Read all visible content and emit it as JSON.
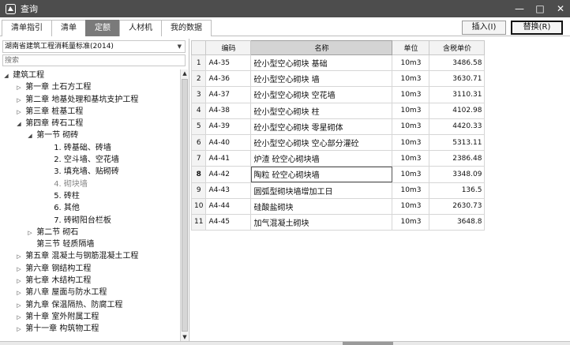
{
  "window": {
    "title": "查询",
    "minimize": "—",
    "maximize": "□",
    "close": "✕"
  },
  "tabs": [
    "清单指引",
    "清单",
    "定额",
    "人材机",
    "我的数据"
  ],
  "buttons": {
    "insert": "插入(I)",
    "replace": "替换(R)"
  },
  "library": {
    "selected": "湖南省建筑工程消耗量标准(2014)",
    "search_placeholder": "搜索"
  },
  "tree": [
    {
      "label": "建筑工程",
      "toggle": "◢",
      "level": 0
    },
    {
      "label": "第一章 土石方工程",
      "toggle": "▷",
      "level": 1
    },
    {
      "label": "第二章 地基处理和基坑支护工程",
      "toggle": "▷",
      "level": 1
    },
    {
      "label": "第三章 桩基工程",
      "toggle": "▷",
      "level": 1
    },
    {
      "label": "第四章 砖石工程",
      "toggle": "◢",
      "level": 1
    },
    {
      "label": "第一节 砌砖",
      "toggle": "◢",
      "level": 2
    },
    {
      "label": "1. 砖基础、砖墙",
      "toggle": "",
      "level": 3
    },
    {
      "label": "2. 空斗墙、空花墙",
      "toggle": "",
      "level": 3
    },
    {
      "label": "3. 填充墙、贴砌砖",
      "toggle": "",
      "level": 3
    },
    {
      "label": "4. 砌块墙",
      "toggle": "",
      "level": 3,
      "muted": true
    },
    {
      "label": "5. 砖柱",
      "toggle": "",
      "level": 3
    },
    {
      "label": "6. 其他",
      "toggle": "",
      "level": 3
    },
    {
      "label": "7. 砖砌阳台栏板",
      "toggle": "",
      "level": 3
    },
    {
      "label": "第二节 砌石",
      "toggle": "▷",
      "level": 2
    },
    {
      "label": "第三节 轻质隔墙",
      "toggle": "",
      "level": 2
    },
    {
      "label": "第五章 混凝土与钢筋混凝土工程",
      "toggle": "▷",
      "level": 1
    },
    {
      "label": "第六章 钢结构工程",
      "toggle": "▷",
      "level": 1
    },
    {
      "label": "第七章 木结构工程",
      "toggle": "▷",
      "level": 1
    },
    {
      "label": "第八章 屋面与防水工程",
      "toggle": "▷",
      "level": 1
    },
    {
      "label": "第九章 保温隔热、防腐工程",
      "toggle": "▷",
      "level": 1
    },
    {
      "label": "第十章 室外附属工程",
      "toggle": "▷",
      "level": 1
    },
    {
      "label": "第十一章 构筑物工程",
      "toggle": "▷",
      "level": 1
    }
  ],
  "table": {
    "columns": [
      "",
      "编码",
      "名称",
      "单位",
      "含税单价"
    ],
    "rows": [
      {
        "no": "1",
        "code": "A4-35",
        "name": "砼小型空心砌块 基础",
        "unit": "10m3",
        "price": "3486.58"
      },
      {
        "no": "2",
        "code": "A4-36",
        "name": "砼小型空心砌块 墙",
        "unit": "10m3",
        "price": "3630.71"
      },
      {
        "no": "3",
        "code": "A4-37",
        "name": "砼小型空心砌块 空花墙",
        "unit": "10m3",
        "price": "3110.31"
      },
      {
        "no": "4",
        "code": "A4-38",
        "name": "砼小型空心砌块 柱",
        "unit": "10m3",
        "price": "4102.98"
      },
      {
        "no": "5",
        "code": "A4-39",
        "name": "砼小型空心砌块 零星砌体",
        "unit": "10m3",
        "price": "4420.33"
      },
      {
        "no": "6",
        "code": "A4-40",
        "name": "砼小型空心砌块 空心部分灌砼",
        "unit": "10m3",
        "price": "5313.11"
      },
      {
        "no": "7",
        "code": "A4-41",
        "name": "炉渣 砼空心砌块墙",
        "unit": "10m3",
        "price": "2386.48"
      },
      {
        "no": "8",
        "code": "A4-42",
        "name": "陶粒 砼空心砌块墙",
        "unit": "10m3",
        "price": "3348.09"
      },
      {
        "no": "9",
        "code": "A4-43",
        "name": "圆弧型砌块墙增加工日",
        "unit": "10m3",
        "price": "136.5"
      },
      {
        "no": "10",
        "code": "A4-44",
        "name": "硅酸盐砌块",
        "unit": "10m3",
        "price": "2630.73"
      },
      {
        "no": "11",
        "code": "A4-45",
        "name": "加气混凝土砌块",
        "unit": "10m3",
        "price": "3648.8"
      }
    ],
    "selected_row": 8
  },
  "colors": {
    "titlebar": "#4d4d4d",
    "active_tab": "#7a7a7a",
    "header_highlight": "#d4d4d4"
  }
}
